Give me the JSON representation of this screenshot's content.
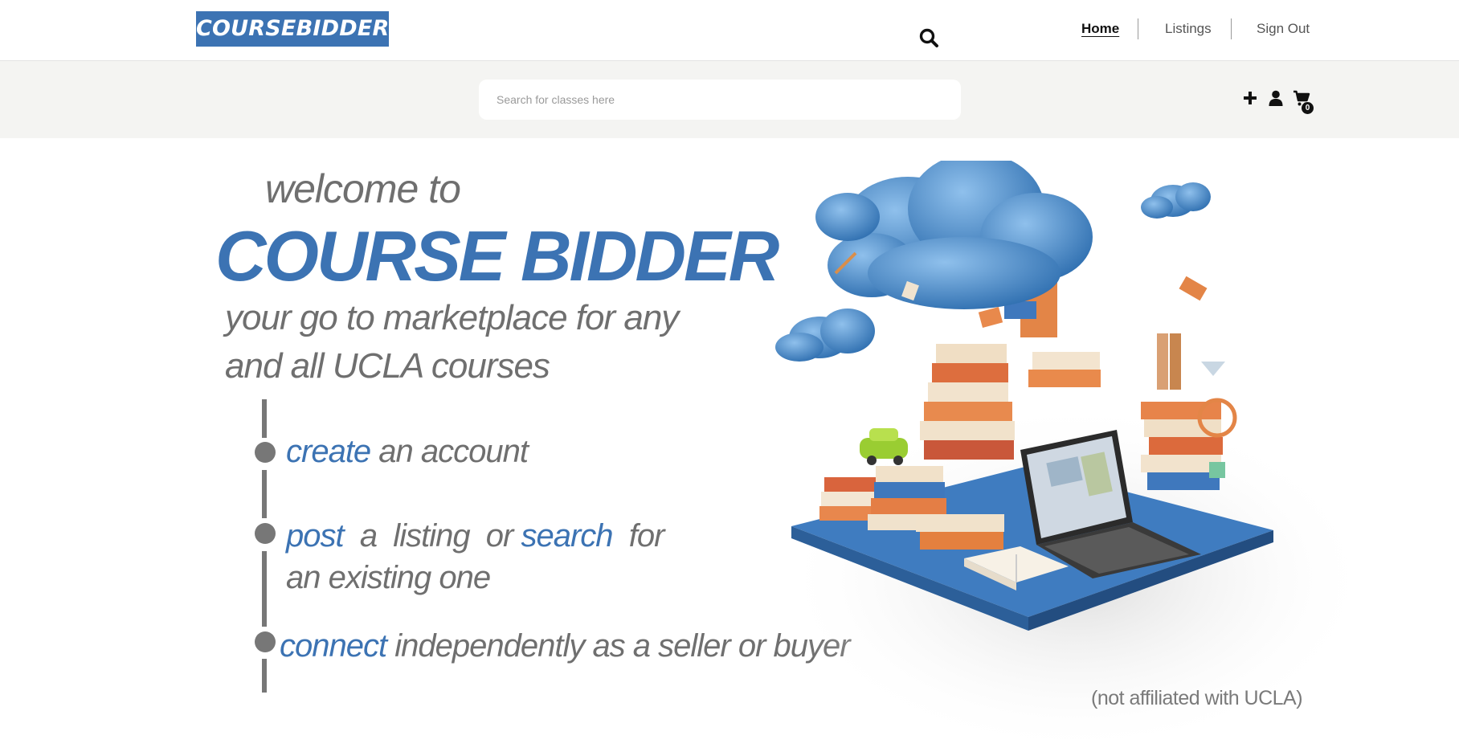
{
  "header": {
    "logo_text": "COURSEBIDDER",
    "nav": {
      "home": "Home",
      "listings": "Listings",
      "sign_out": "Sign Out"
    }
  },
  "search": {
    "placeholder": "Search for classes here",
    "value": "",
    "button_icon": "search-icon"
  },
  "toolbar": {
    "add_icon": "plus-icon",
    "profile_icon": "user-icon",
    "cart_icon": "cart-icon",
    "cart_count": "0"
  },
  "hero": {
    "welcome": "welcome to",
    "brand": "COURSE BIDDER",
    "tagline_line1": "your go to marketplace for any",
    "tagline_line2": "and all UCLA courses",
    "steps": [
      {
        "highlight": "create",
        "rest": " an account"
      },
      {
        "highlight": "post",
        "rest": "  a  listing  or ",
        "highlight2": "search",
        "rest2": "  for",
        "line2": "an existing one"
      },
      {
        "highlight": "connect",
        "rest": " independently as a seller or buyer"
      }
    ],
    "disclaimer": "(not affiliated with UCLA)",
    "illustration": "books-clouds-laptop-illustration"
  },
  "colors": {
    "accent": "#3c73b3",
    "text_gray": "#6f6f6f",
    "search_strip": "#f4f4f2"
  }
}
